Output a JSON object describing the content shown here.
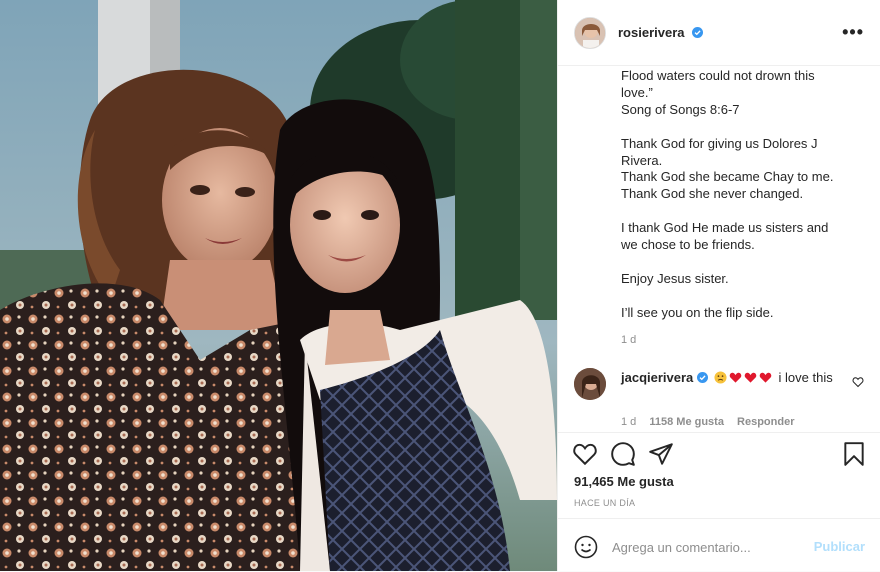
{
  "post": {
    "username": "rosierivera",
    "caption_lines": [
      "Flood waters could not drown this",
      "love.”",
      "Song of Songs 8:6-7",
      "",
      "Thank God for giving us Dolores J",
      "Rivera.",
      "Thank God she became Chay to me.",
      "Thank God she never changed.",
      "",
      "I thank God He made us sisters and",
      "we chose to be friends.",
      "",
      "Enjoy Jesus sister.",
      "",
      "I’ll see you on the flip side."
    ],
    "caption_time": "1 d",
    "likes": "91,465 Me gusta",
    "date": "HACE UN DÍA"
  },
  "comment": {
    "username": "jacqierivera",
    "text_after_emoji": "i love this",
    "time": "1 d",
    "likes": "1158 Me gusta",
    "reply": "Responder"
  },
  "add_comment": {
    "placeholder": "Agrega un comentario...",
    "post_label": "Publicar"
  },
  "icons": {
    "more": "more-options-icon",
    "verified": "verified-badge-icon",
    "like": "heart-icon",
    "comment": "comment-icon",
    "share": "share-icon",
    "save": "bookmark-icon",
    "emoji": "emoji-icon"
  },
  "colors": {
    "verified": "#3897f0",
    "heart_red": "#e0182d",
    "publish_disabled": "#b2dffc"
  }
}
